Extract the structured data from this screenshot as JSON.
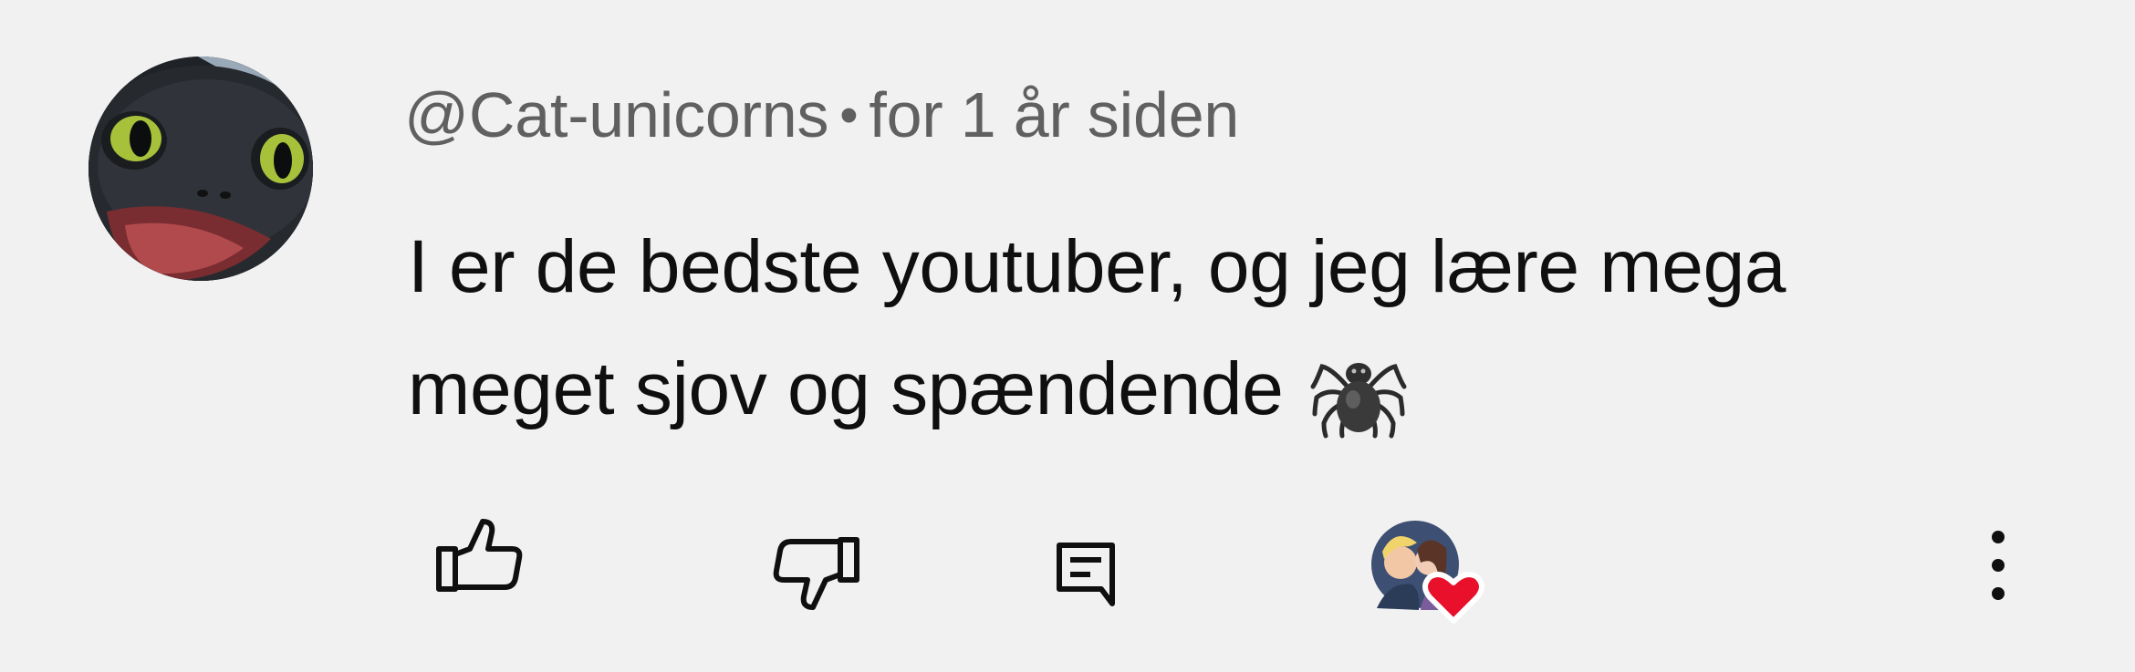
{
  "comment": {
    "author_handle": "@Cat-unicorns",
    "separator": "•",
    "timestamp": "for 1 år siden",
    "text_line_1": "I er de bedste youtuber, og jeg lære mega",
    "text_line_2": "meget sjov og spændende",
    "emoji": "spider-emoji"
  },
  "actions": {
    "like_icon": "thumbs-up-icon",
    "dislike_icon": "thumbs-down-icon",
    "reply_icon": "reply-comment-icon",
    "creator_heart_icon": "creator-heart-icon",
    "more_icon": "more-vertical-icon"
  },
  "colors": {
    "background": "#f1f1f1",
    "text_primary": "#0f0f0f",
    "text_secondary": "#606060",
    "heart": "#e8102a"
  }
}
